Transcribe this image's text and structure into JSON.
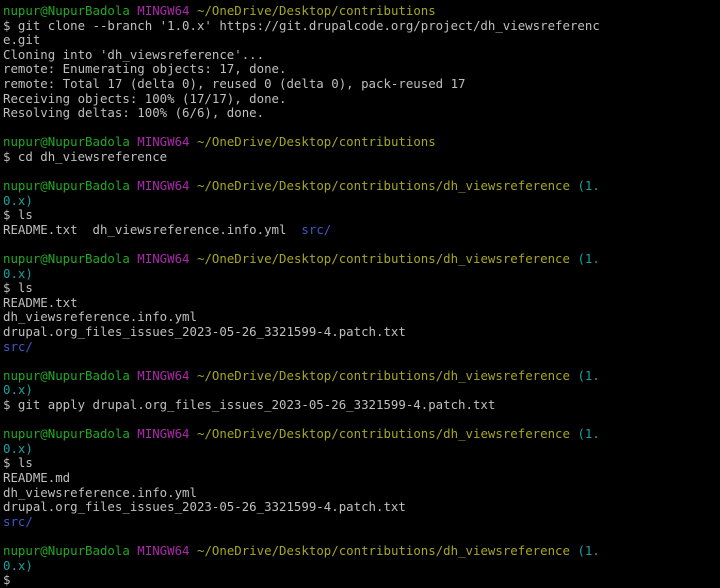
{
  "terminal": {
    "app": "MINGW64 Git Bash terminal",
    "palette": {
      "bg": "#000000",
      "fg": "#bfbfbf",
      "green": "#22a822",
      "magenta": "#aa28aa",
      "yellow": "#a6a621",
      "cyan": "#17a2a2",
      "blue": "#3b5bc8"
    },
    "lines": [
      {
        "segments": [
          {
            "t": "nupur@NupurBadola",
            "c": "green",
            "n": "prompt-user-host"
          },
          {
            "t": " "
          },
          {
            "t": "MINGW64",
            "c": "magenta",
            "n": "prompt-platform"
          },
          {
            "t": " "
          },
          {
            "t": "~/OneDrive/Desktop/contributions",
            "c": "yellow",
            "n": "prompt-cwd"
          }
        ]
      },
      {
        "segments": [
          {
            "t": "$ git clone --branch '1.0.x' https://git.drupalcode.org/project/dh_viewsreferenc",
            "n": "command"
          }
        ]
      },
      {
        "segments": [
          {
            "t": "e.git",
            "n": "command"
          }
        ]
      },
      {
        "segments": [
          {
            "t": "Cloning into 'dh_viewsreference'...",
            "n": "output"
          }
        ]
      },
      {
        "segments": [
          {
            "t": "remote: Enumerating objects: 17, done.",
            "n": "output"
          }
        ]
      },
      {
        "segments": [
          {
            "t": "remote: Total 17 (delta 0), reused 0 (delta 0), pack-reused 17",
            "n": "output"
          }
        ]
      },
      {
        "segments": [
          {
            "t": "Receiving objects: 100% (17/17), done.",
            "n": "output"
          }
        ]
      },
      {
        "segments": [
          {
            "t": "Resolving deltas: 100% (6/6), done.",
            "n": "output"
          }
        ]
      },
      {
        "segments": []
      },
      {
        "segments": [
          {
            "t": "nupur@NupurBadola",
            "c": "green",
            "n": "prompt-user-host"
          },
          {
            "t": " "
          },
          {
            "t": "MINGW64",
            "c": "magenta",
            "n": "prompt-platform"
          },
          {
            "t": " "
          },
          {
            "t": "~/OneDrive/Desktop/contributions",
            "c": "yellow",
            "n": "prompt-cwd"
          }
        ]
      },
      {
        "segments": [
          {
            "t": "$ cd dh_viewsreference",
            "n": "command"
          }
        ]
      },
      {
        "segments": []
      },
      {
        "segments": [
          {
            "t": "nupur@NupurBadola",
            "c": "green",
            "n": "prompt-user-host"
          },
          {
            "t": " "
          },
          {
            "t": "MINGW64",
            "c": "magenta",
            "n": "prompt-platform"
          },
          {
            "t": " "
          },
          {
            "t": "~/OneDrive/Desktop/contributions/dh_viewsreference",
            "c": "yellow",
            "n": "prompt-cwd"
          },
          {
            "t": " "
          },
          {
            "t": "(1.",
            "c": "cyan",
            "n": "prompt-git-branch"
          }
        ]
      },
      {
        "segments": [
          {
            "t": "0.x)",
            "c": "cyan",
            "n": "prompt-git-branch"
          }
        ]
      },
      {
        "segments": [
          {
            "t": "$ ls",
            "n": "command"
          }
        ]
      },
      {
        "segments": [
          {
            "t": "README.txt  dh_viewsreference.info.yml  ",
            "n": "output"
          },
          {
            "t": "src/",
            "c": "blue",
            "n": "directory-entry"
          }
        ]
      },
      {
        "segments": []
      },
      {
        "segments": [
          {
            "t": "nupur@NupurBadola",
            "c": "green",
            "n": "prompt-user-host"
          },
          {
            "t": " "
          },
          {
            "t": "MINGW64",
            "c": "magenta",
            "n": "prompt-platform"
          },
          {
            "t": " "
          },
          {
            "t": "~/OneDrive/Desktop/contributions/dh_viewsreference",
            "c": "yellow",
            "n": "prompt-cwd"
          },
          {
            "t": " "
          },
          {
            "t": "(1.",
            "c": "cyan",
            "n": "prompt-git-branch"
          }
        ]
      },
      {
        "segments": [
          {
            "t": "0.x)",
            "c": "cyan",
            "n": "prompt-git-branch"
          }
        ]
      },
      {
        "segments": [
          {
            "t": "$ ls",
            "n": "command"
          }
        ]
      },
      {
        "segments": [
          {
            "t": "README.txt",
            "n": "output"
          }
        ]
      },
      {
        "segments": [
          {
            "t": "dh_viewsreference.info.yml",
            "n": "output"
          }
        ]
      },
      {
        "segments": [
          {
            "t": "drupal.org_files_issues_2023-05-26_3321599-4.patch.txt",
            "n": "output"
          }
        ]
      },
      {
        "segments": [
          {
            "t": "src/",
            "c": "blue",
            "n": "directory-entry"
          }
        ]
      },
      {
        "segments": []
      },
      {
        "segments": [
          {
            "t": "nupur@NupurBadola",
            "c": "green",
            "n": "prompt-user-host"
          },
          {
            "t": " "
          },
          {
            "t": "MINGW64",
            "c": "magenta",
            "n": "prompt-platform"
          },
          {
            "t": " "
          },
          {
            "t": "~/OneDrive/Desktop/contributions/dh_viewsreference",
            "c": "yellow",
            "n": "prompt-cwd"
          },
          {
            "t": " "
          },
          {
            "t": "(1.",
            "c": "cyan",
            "n": "prompt-git-branch"
          }
        ]
      },
      {
        "segments": [
          {
            "t": "0.x)",
            "c": "cyan",
            "n": "prompt-git-branch"
          }
        ]
      },
      {
        "segments": [
          {
            "t": "$ git apply drupal.org_files_issues_2023-05-26_3321599-4.patch.txt",
            "n": "command"
          }
        ]
      },
      {
        "segments": []
      },
      {
        "segments": [
          {
            "t": "nupur@NupurBadola",
            "c": "green",
            "n": "prompt-user-host"
          },
          {
            "t": " "
          },
          {
            "t": "MINGW64",
            "c": "magenta",
            "n": "prompt-platform"
          },
          {
            "t": " "
          },
          {
            "t": "~/OneDrive/Desktop/contributions/dh_viewsreference",
            "c": "yellow",
            "n": "prompt-cwd"
          },
          {
            "t": " "
          },
          {
            "t": "(1.",
            "c": "cyan",
            "n": "prompt-git-branch"
          }
        ]
      },
      {
        "segments": [
          {
            "t": "0.x)",
            "c": "cyan",
            "n": "prompt-git-branch"
          }
        ]
      },
      {
        "segments": [
          {
            "t": "$ ls",
            "n": "command"
          }
        ]
      },
      {
        "segments": [
          {
            "t": "README.md",
            "n": "output"
          }
        ]
      },
      {
        "segments": [
          {
            "t": "dh_viewsreference.info.yml",
            "n": "output"
          }
        ]
      },
      {
        "segments": [
          {
            "t": "drupal.org_files_issues_2023-05-26_3321599-4.patch.txt",
            "n": "output"
          }
        ]
      },
      {
        "segments": [
          {
            "t": "src/",
            "c": "blue",
            "n": "directory-entry"
          }
        ]
      },
      {
        "segments": []
      },
      {
        "segments": [
          {
            "t": "nupur@NupurBadola",
            "c": "green",
            "n": "prompt-user-host"
          },
          {
            "t": " "
          },
          {
            "t": "MINGW64",
            "c": "magenta",
            "n": "prompt-platform"
          },
          {
            "t": " "
          },
          {
            "t": "~/OneDrive/Desktop/contributions/dh_viewsreference",
            "c": "yellow",
            "n": "prompt-cwd"
          },
          {
            "t": " "
          },
          {
            "t": "(1.",
            "c": "cyan",
            "n": "prompt-git-branch"
          }
        ]
      },
      {
        "segments": [
          {
            "t": "0.x)",
            "c": "cyan",
            "n": "prompt-git-branch"
          }
        ]
      },
      {
        "segments": [
          {
            "t": "$",
            "n": "prompt-dollar"
          }
        ]
      }
    ]
  }
}
